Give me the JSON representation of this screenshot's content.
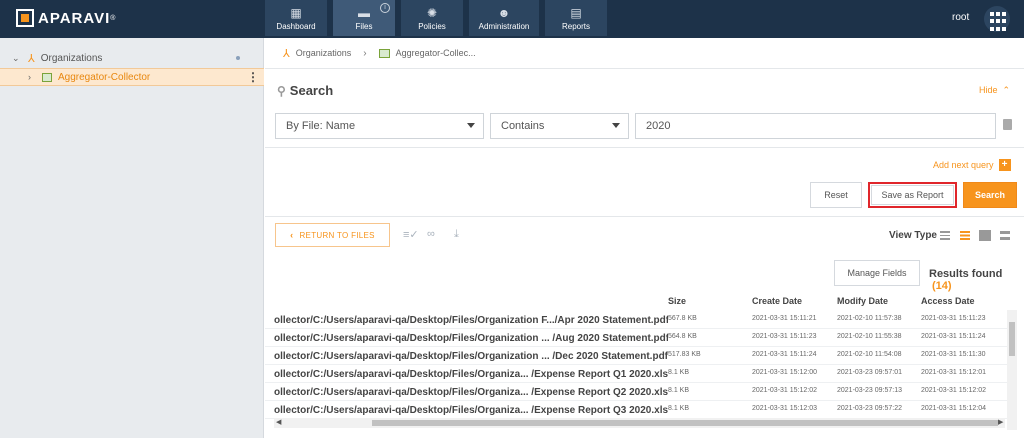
{
  "brand": {
    "name": "APARAVI",
    "tm": "®"
  },
  "nav": [
    {
      "label": "Dashboard",
      "icon": "dashboard-icon"
    },
    {
      "label": "Files",
      "icon": "folder-icon",
      "active": true,
      "info": "i"
    },
    {
      "label": "Policies",
      "icon": "gear-icon"
    },
    {
      "label": "Administration",
      "icon": "users-icon"
    },
    {
      "label": "Reports",
      "icon": "clipboard-icon"
    }
  ],
  "user": {
    "name": "root"
  },
  "sidebar": {
    "root_label": "Organizations",
    "child_label": "Aggregator-Collector"
  },
  "breadcrumb": {
    "root": "Organizations",
    "current": "Aggregator-Collec..."
  },
  "search": {
    "title": "Search",
    "hide_label": "Hide",
    "field_select": "By File: Name",
    "operator_select": "Contains",
    "value": "2020",
    "add_query_label": "Add next query",
    "add_query_plus": "+",
    "reset_label": "Reset",
    "save_report_label": "Save as Report",
    "search_label": "Search"
  },
  "results": {
    "return_label": "RETURN TO FILES",
    "view_type_label": "View Type",
    "manage_fields_label": "Manage Fields",
    "results_found_label": "Results found",
    "results_count": "(14)",
    "columns": [
      "Size",
      "Create Date",
      "Modify Date",
      "Access Date"
    ],
    "rows": [
      {
        "path": "ollector/C:/Users/aparavi-qa/Desktop/Files/Organization F.../Apr 2020 Statement.pdf",
        "size": "567.8 KB",
        "create": "2021-03-31 15:11:21",
        "modify": "2021-02-10 11:57:38",
        "access": "2021-03-31 15:11:23"
      },
      {
        "path": "ollector/C:/Users/aparavi-qa/Desktop/Files/Organization ... /Aug 2020 Statement.pdf",
        "size": "564.8 KB",
        "create": "2021-03-31 15:11:23",
        "modify": "2021-02-10 11:55:38",
        "access": "2021-03-31 15:11:24"
      },
      {
        "path": "ollector/C:/Users/aparavi-qa/Desktop/Files/Organization ... /Dec 2020 Statement.pdf",
        "size": "517.83 KB",
        "create": "2021-03-31 15:11:24",
        "modify": "2021-02-10 11:54:08",
        "access": "2021-03-31 15:11:30"
      },
      {
        "path": "ollector/C:/Users/aparavi-qa/Desktop/Files/Organiza... /Expense Report Q1 2020.xlsx",
        "size": "8.1 KB",
        "create": "2021-03-31 15:12:00",
        "modify": "2021-03-23 09:57:01",
        "access": "2021-03-31 15:12:01"
      },
      {
        "path": "ollector/C:/Users/aparavi-qa/Desktop/Files/Organiza... /Expense Report Q2 2020.xlsx",
        "size": "8.1 KB",
        "create": "2021-03-31 15:12:02",
        "modify": "2021-03-23 09:57:13",
        "access": "2021-03-31 15:12:02"
      },
      {
        "path": "ollector/C:/Users/aparavi-qa/Desktop/Files/Organiza... /Expense Report Q3 2020.xlsx",
        "size": "8.1 KB",
        "create": "2021-03-31 15:12:03",
        "modify": "2021-03-23 09:57:22",
        "access": "2021-03-31 15:12:04"
      }
    ]
  },
  "colors": {
    "accent": "#f7941d",
    "topbar": "#1d3249",
    "highlight": "#e0262b"
  }
}
